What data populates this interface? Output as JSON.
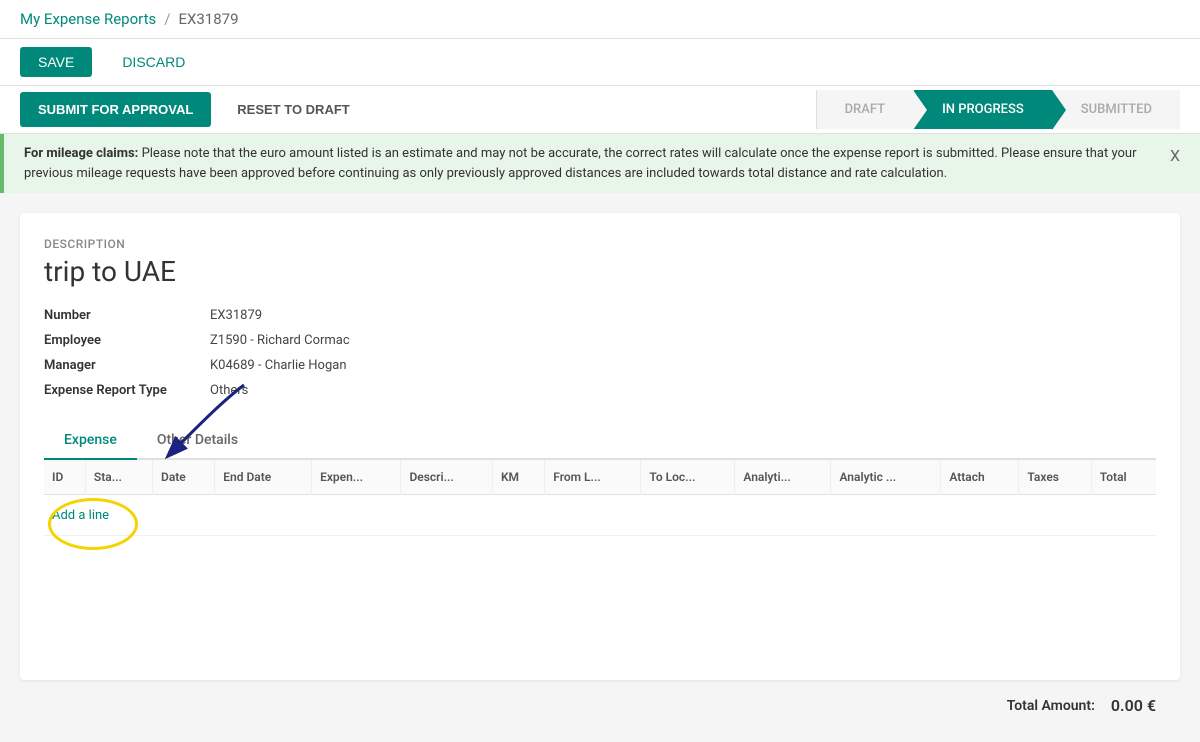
{
  "breadcrumb": {
    "parent": "My Expense Reports",
    "separator": "/",
    "current": "EX31879"
  },
  "toolbar": {
    "save_label": "SAVE",
    "discard_label": "DISCARD"
  },
  "status_bar": {
    "submit_label": "SUBMIT FOR APPROVAL",
    "reset_label": "RESET TO DRAFT",
    "steps": [
      {
        "id": "draft",
        "label": "DRAFT",
        "active": false
      },
      {
        "id": "in_progress",
        "label": "IN PROGRESS",
        "active": true
      },
      {
        "id": "submitted",
        "label": "SUBMITTED",
        "active": false
      }
    ]
  },
  "info_banner": {
    "text": "For mileage claims: Please note that the euro amount listed is an estimate and may not be accurate, the correct rates will calculate once the expense report is submitted. Please ensure that your previous mileage requests have been approved before continuing as only previously approved distances are included towards total distance and rate calculation.",
    "close_label": "X"
  },
  "form": {
    "description_label": "Description",
    "title": "trip to UAE",
    "fields": [
      {
        "label": "Number",
        "value": "EX31879"
      },
      {
        "label": "Employee",
        "value": "Z1590 - Richard Cormac"
      },
      {
        "label": "Manager",
        "value": "K04689 - Charlie Hogan"
      },
      {
        "label": "Expense Report Type",
        "value": "Others"
      }
    ]
  },
  "tabs": [
    {
      "id": "expense",
      "label": "Expense",
      "active": true
    },
    {
      "id": "other_details",
      "label": "Other Details",
      "active": false
    }
  ],
  "table": {
    "columns": [
      {
        "id": "id",
        "label": "ID"
      },
      {
        "id": "status",
        "label": "Sta..."
      },
      {
        "id": "date",
        "label": "Date"
      },
      {
        "id": "end_date",
        "label": "End Date"
      },
      {
        "id": "expense_type",
        "label": "Expen..."
      },
      {
        "id": "description",
        "label": "Descri..."
      },
      {
        "id": "km",
        "label": "KM"
      },
      {
        "id": "from_loc",
        "label": "From L..."
      },
      {
        "id": "to_loc",
        "label": "To Loc..."
      },
      {
        "id": "analytic1",
        "label": "Analyti..."
      },
      {
        "id": "analytic2",
        "label": "Analytic ..."
      },
      {
        "id": "attach",
        "label": "Attach"
      },
      {
        "id": "taxes",
        "label": "Taxes"
      },
      {
        "id": "total",
        "label": "Total"
      }
    ],
    "rows": [],
    "add_line_label": "Add a line"
  },
  "footer": {
    "total_label": "Total Amount:",
    "total_value": "0.00 €"
  }
}
